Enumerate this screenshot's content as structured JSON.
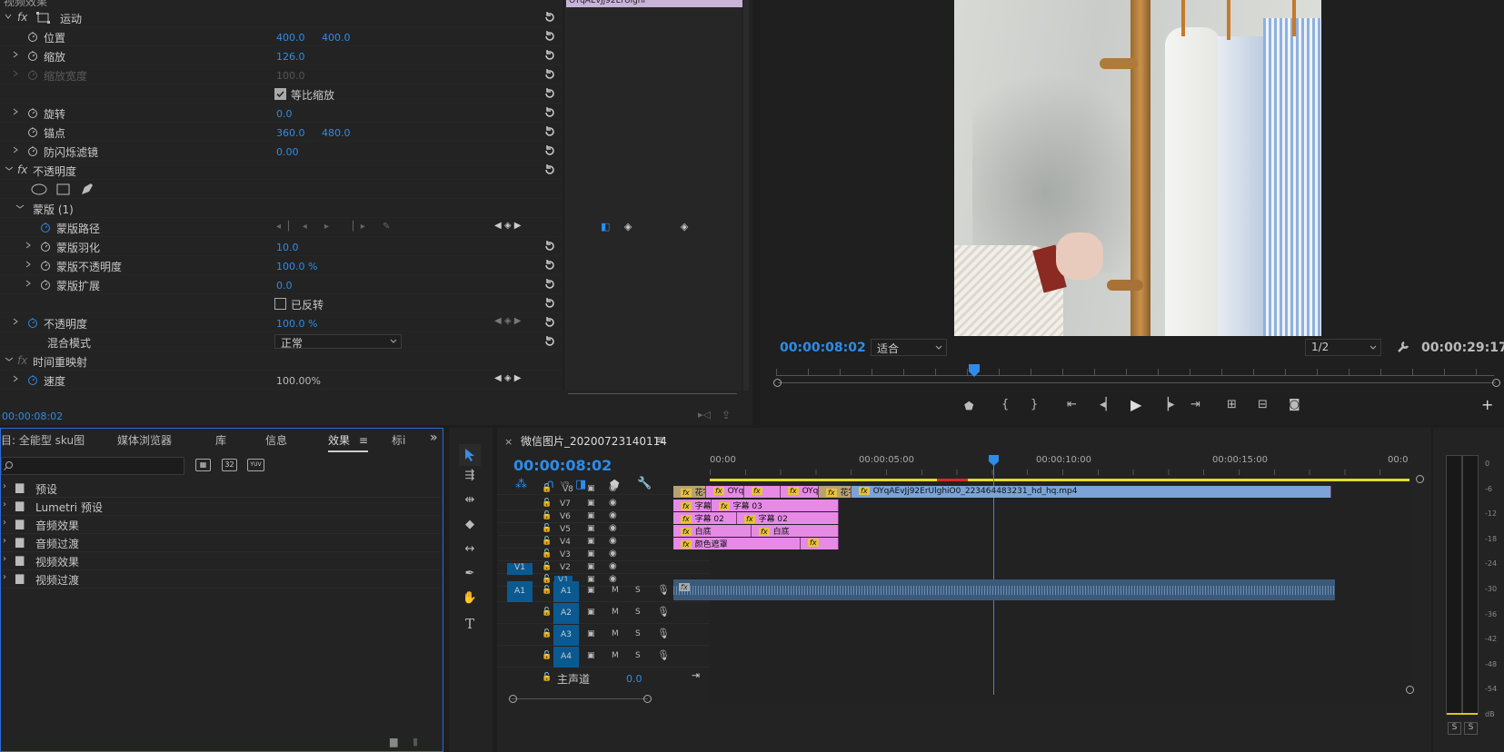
{
  "effect_controls": {
    "top_label": "视频效果",
    "motion": {
      "label": "运动"
    },
    "position": {
      "label": "位置",
      "x": "400.0",
      "y": "400.0"
    },
    "scale": {
      "label": "缩放",
      "value": "126.0"
    },
    "scale_width": {
      "label": "缩放宽度",
      "value": "100.0"
    },
    "uniform_scale": {
      "label": "等比缩放"
    },
    "rotation": {
      "label": "旋转",
      "value": "0.0"
    },
    "anchor": {
      "label": "锚点",
      "x": "360.0",
      "y": "480.0"
    },
    "anti_flicker": {
      "label": "防闪烁滤镜",
      "value": "0.00"
    },
    "opacity_section": {
      "label": "不透明度"
    },
    "mask": {
      "label": "蒙版 (1)"
    },
    "mask_path": {
      "label": "蒙版路径"
    },
    "mask_feather": {
      "label": "蒙版羽化",
      "value": "10.0"
    },
    "mask_opacity": {
      "label": "蒙版不透明度",
      "value": "100.0 %"
    },
    "mask_expansion": {
      "label": "蒙版扩展",
      "value": "0.0"
    },
    "inverted": {
      "label": "已反转"
    },
    "opacity": {
      "label": "不透明度",
      "value": "100.0 %"
    },
    "blend_mode": {
      "label": "混合模式",
      "value": "正常"
    },
    "time_remap": {
      "label": "时间重映射"
    },
    "speed": {
      "label": "速度",
      "value": "100.00%"
    },
    "timecode": "00:00:08:02",
    "clip_thumb_label": "OYqAEvJj92ErUlghi"
  },
  "program_monitor": {
    "timecode": "00:00:08:02",
    "fit_label": "适合",
    "resolution": "1/2",
    "duration": "00:00:29:17"
  },
  "project_panel": {
    "tabs": [
      "目: 全能型 sku图",
      "媒体浏览器",
      "库",
      "信息",
      "效果",
      "标i"
    ],
    "active_tab": "效果",
    "icons": [
      "32",
      "YUV"
    ],
    "folders": [
      "预设",
      "Lumetri 预设",
      "音频效果",
      "音频过渡",
      "视频效果",
      "视频过渡"
    ]
  },
  "timeline": {
    "sequence_name": "微信图片_20200723140114",
    "timecode": "00:00:08:02",
    "ruler": [
      "00:00",
      "00:00:05:00",
      "00:00:10:00",
      "00:00:15:00",
      "00:0"
    ],
    "video_tracks": [
      "V8",
      "V7",
      "V6",
      "V5",
      "V4",
      "V3",
      "V2",
      "V1"
    ],
    "audio_tracks": [
      "A1",
      "A2",
      "A3",
      "A4"
    ],
    "source_v": "V1",
    "source_a": "A1",
    "mute": "M",
    "solo": "S",
    "master_label": "主声道",
    "master_value": "0.0",
    "v8_peek": "V9",
    "clips": {
      "v7_a": "花字模",
      "v7_b": "OYqA",
      "v7_c": "OYq",
      "v7_d": "花字模",
      "v7_main": "OYqAEvJj92ErUlghiO0_223464483231_hd_hq.mp4",
      "v6_a": "字幕 03",
      "v6_b": "字幕 03",
      "v5_a": "字幕 02",
      "v5_b": "字幕 02",
      "v4_a": "白底",
      "v4_b": "白底",
      "v3_a": "颜色遮罩"
    },
    "fx_badge": "fx"
  },
  "meter": {
    "scale": [
      "0",
      "-6",
      "-12",
      "-18",
      "-24",
      "-30",
      "-36",
      "-42",
      "-48",
      "-54",
      "dB"
    ],
    "solo_buttons": [
      "S",
      "S"
    ]
  },
  "colors": {
    "accent_blue": "#2d8ceb",
    "clip_pink": "#e68ae6",
    "clip_video": "#7ba3d6",
    "fx_yellow": "#e8c33a",
    "audio_track": "#3b5a7a"
  }
}
